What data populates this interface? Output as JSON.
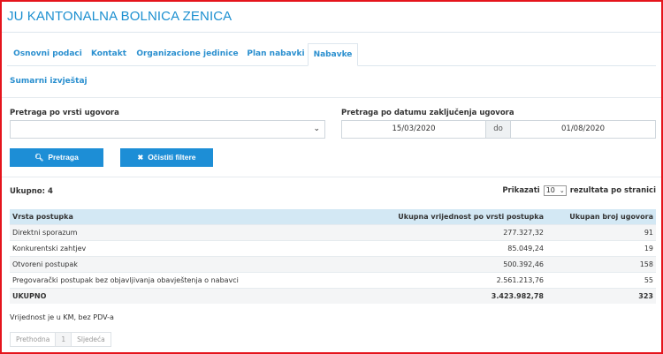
{
  "header": {
    "title": "JU KANTONALNA BOLNICA ZENICA"
  },
  "tabs": [
    {
      "label": "Osnovni podaci"
    },
    {
      "label": "Kontakt"
    },
    {
      "label": "Organizacione jedinice"
    },
    {
      "label": "Plan nabavki"
    },
    {
      "label": "Nabavke"
    }
  ],
  "section": {
    "title": "Sumarni izvještaj"
  },
  "filters": {
    "type_label": "Pretraga po vrsti ugovora",
    "type_value": "",
    "date_label": "Pretraga po datumu zaključenja ugovora",
    "date_from": "15/03/2020",
    "date_sep": "do",
    "date_to": "01/08/2020",
    "search_button": "Pretraga",
    "clear_button": "Očistiti filtere"
  },
  "summary": {
    "count_label": "Ukupno: 4",
    "page_size_prefix": "Prikazati",
    "page_size": "10",
    "page_size_suffix": "rezultata po stranici"
  },
  "table": {
    "headers": [
      "Vrsta postupka",
      "Ukupna vrijednost po vrsti postupka",
      "Ukupan broj ugovora"
    ],
    "rows": [
      [
        "Direktni sporazum",
        "277.327,32",
        "91"
      ],
      [
        "Konkurentski zahtjev",
        "85.049,24",
        "19"
      ],
      [
        "Otvoreni postupak",
        "500.392,46",
        "158"
      ],
      [
        "Pregovarački postupak bez objavljivanja obavještenja o nabavci",
        "2.561.213,76",
        "55"
      ]
    ],
    "total": [
      "UKUPNO",
      "3.423.982,78",
      "323"
    ]
  },
  "note": "Vrijednost je u KM, bez PDV-a",
  "pagination": {
    "prev": "Prethodna",
    "page": "1",
    "next": "Sljedeća"
  },
  "colors": {
    "accent": "#1d8ed6",
    "header_row": "#d3e8f4",
    "frame": "#e5141c"
  }
}
